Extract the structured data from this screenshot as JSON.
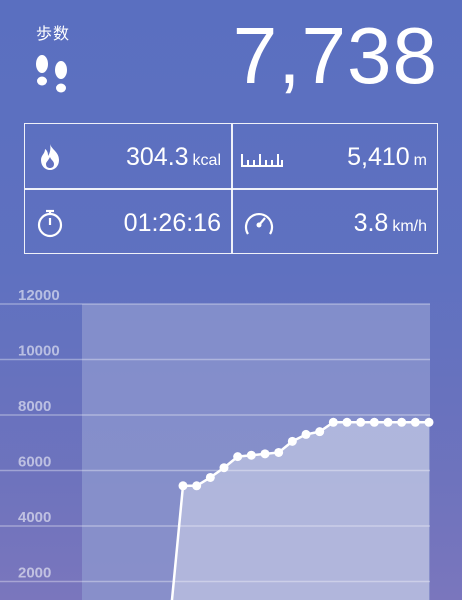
{
  "header": {
    "steps_label": "歩数",
    "steps_value": "7,738",
    "icon": "footprints-icon"
  },
  "stats": {
    "calories": {
      "value": "304.3",
      "unit": "kcal",
      "icon": "flame-icon"
    },
    "distance": {
      "value": "5,410",
      "unit": "m",
      "icon": "ruler-icon"
    },
    "time": {
      "value": "01:26:16",
      "unit": "",
      "icon": "stopwatch-icon"
    },
    "speed": {
      "value": "3.8",
      "unit": "km/h",
      "icon": "speedometer-icon"
    }
  },
  "colors": {
    "background_top": "#5a6fc0",
    "plot_area": "#8d98cf",
    "line": "#ffffff"
  },
  "chart_data": {
    "type": "line",
    "title": "",
    "xlabel": "",
    "ylabel": "",
    "ylim": [
      0,
      12000
    ],
    "yticks": [
      2000,
      4000,
      6000,
      8000,
      10000,
      12000
    ],
    "grid": true,
    "series": [
      {
        "values": [
          0,
          5450,
          5450,
          5750,
          6100,
          6500,
          6550,
          6600,
          6650,
          7050,
          7300,
          7400,
          7738,
          7738,
          7738,
          7738,
          7738,
          7738,
          7738,
          7738
        ]
      }
    ]
  }
}
